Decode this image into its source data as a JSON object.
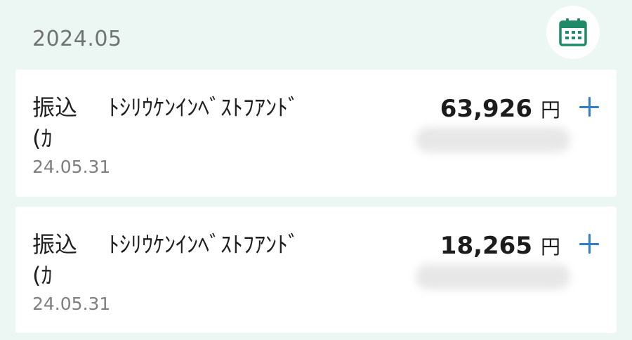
{
  "header": {
    "month": "2024.05",
    "calendar_icon": "calendar-icon",
    "accent_color": "#1f8a68"
  },
  "transactions": [
    {
      "type": "振込",
      "payee_line1": "ﾄｼﾘｳｹﾝｲﾝﾍﾞｽﾄﾌｱﾝﾄﾞ",
      "payee_line2": "(ｶ",
      "date": "24.05.31",
      "amount": "63,926",
      "currency": "円",
      "action_icon": "plus-icon"
    },
    {
      "type": "振込",
      "payee_line1": "ﾄｼﾘｳｹﾝｲﾝﾍﾞｽﾄﾌｱﾝﾄﾞ",
      "payee_line2": "(ｶ",
      "date": "24.05.31",
      "amount": "18,265",
      "currency": "円",
      "action_icon": "plus-icon"
    }
  ]
}
